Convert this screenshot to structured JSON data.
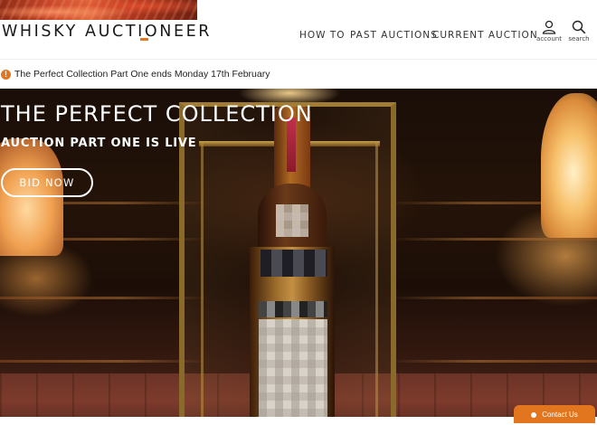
{
  "header": {
    "logo_text": "WHISKY AUCTIONEER",
    "nav": [
      {
        "label": "HOW TO"
      },
      {
        "label": "PAST AUCTIONS"
      },
      {
        "label": "CURRENT AUCTION"
      }
    ],
    "account_label": "account",
    "search_label": "search"
  },
  "notice": {
    "icon": "exclamation-icon",
    "text": "The Perfect Collection Part One ends Monday 17th February"
  },
  "hero": {
    "title": "THE PERFECT COLLECTION",
    "subtitle": "AUCTION PART ONE IS LIVE",
    "button_label": "BID NOW"
  },
  "contact": {
    "label": "Contact Us"
  },
  "colors": {
    "accent": "#e2761f",
    "text": "#222222",
    "hero_bg": "#1a0e08"
  }
}
